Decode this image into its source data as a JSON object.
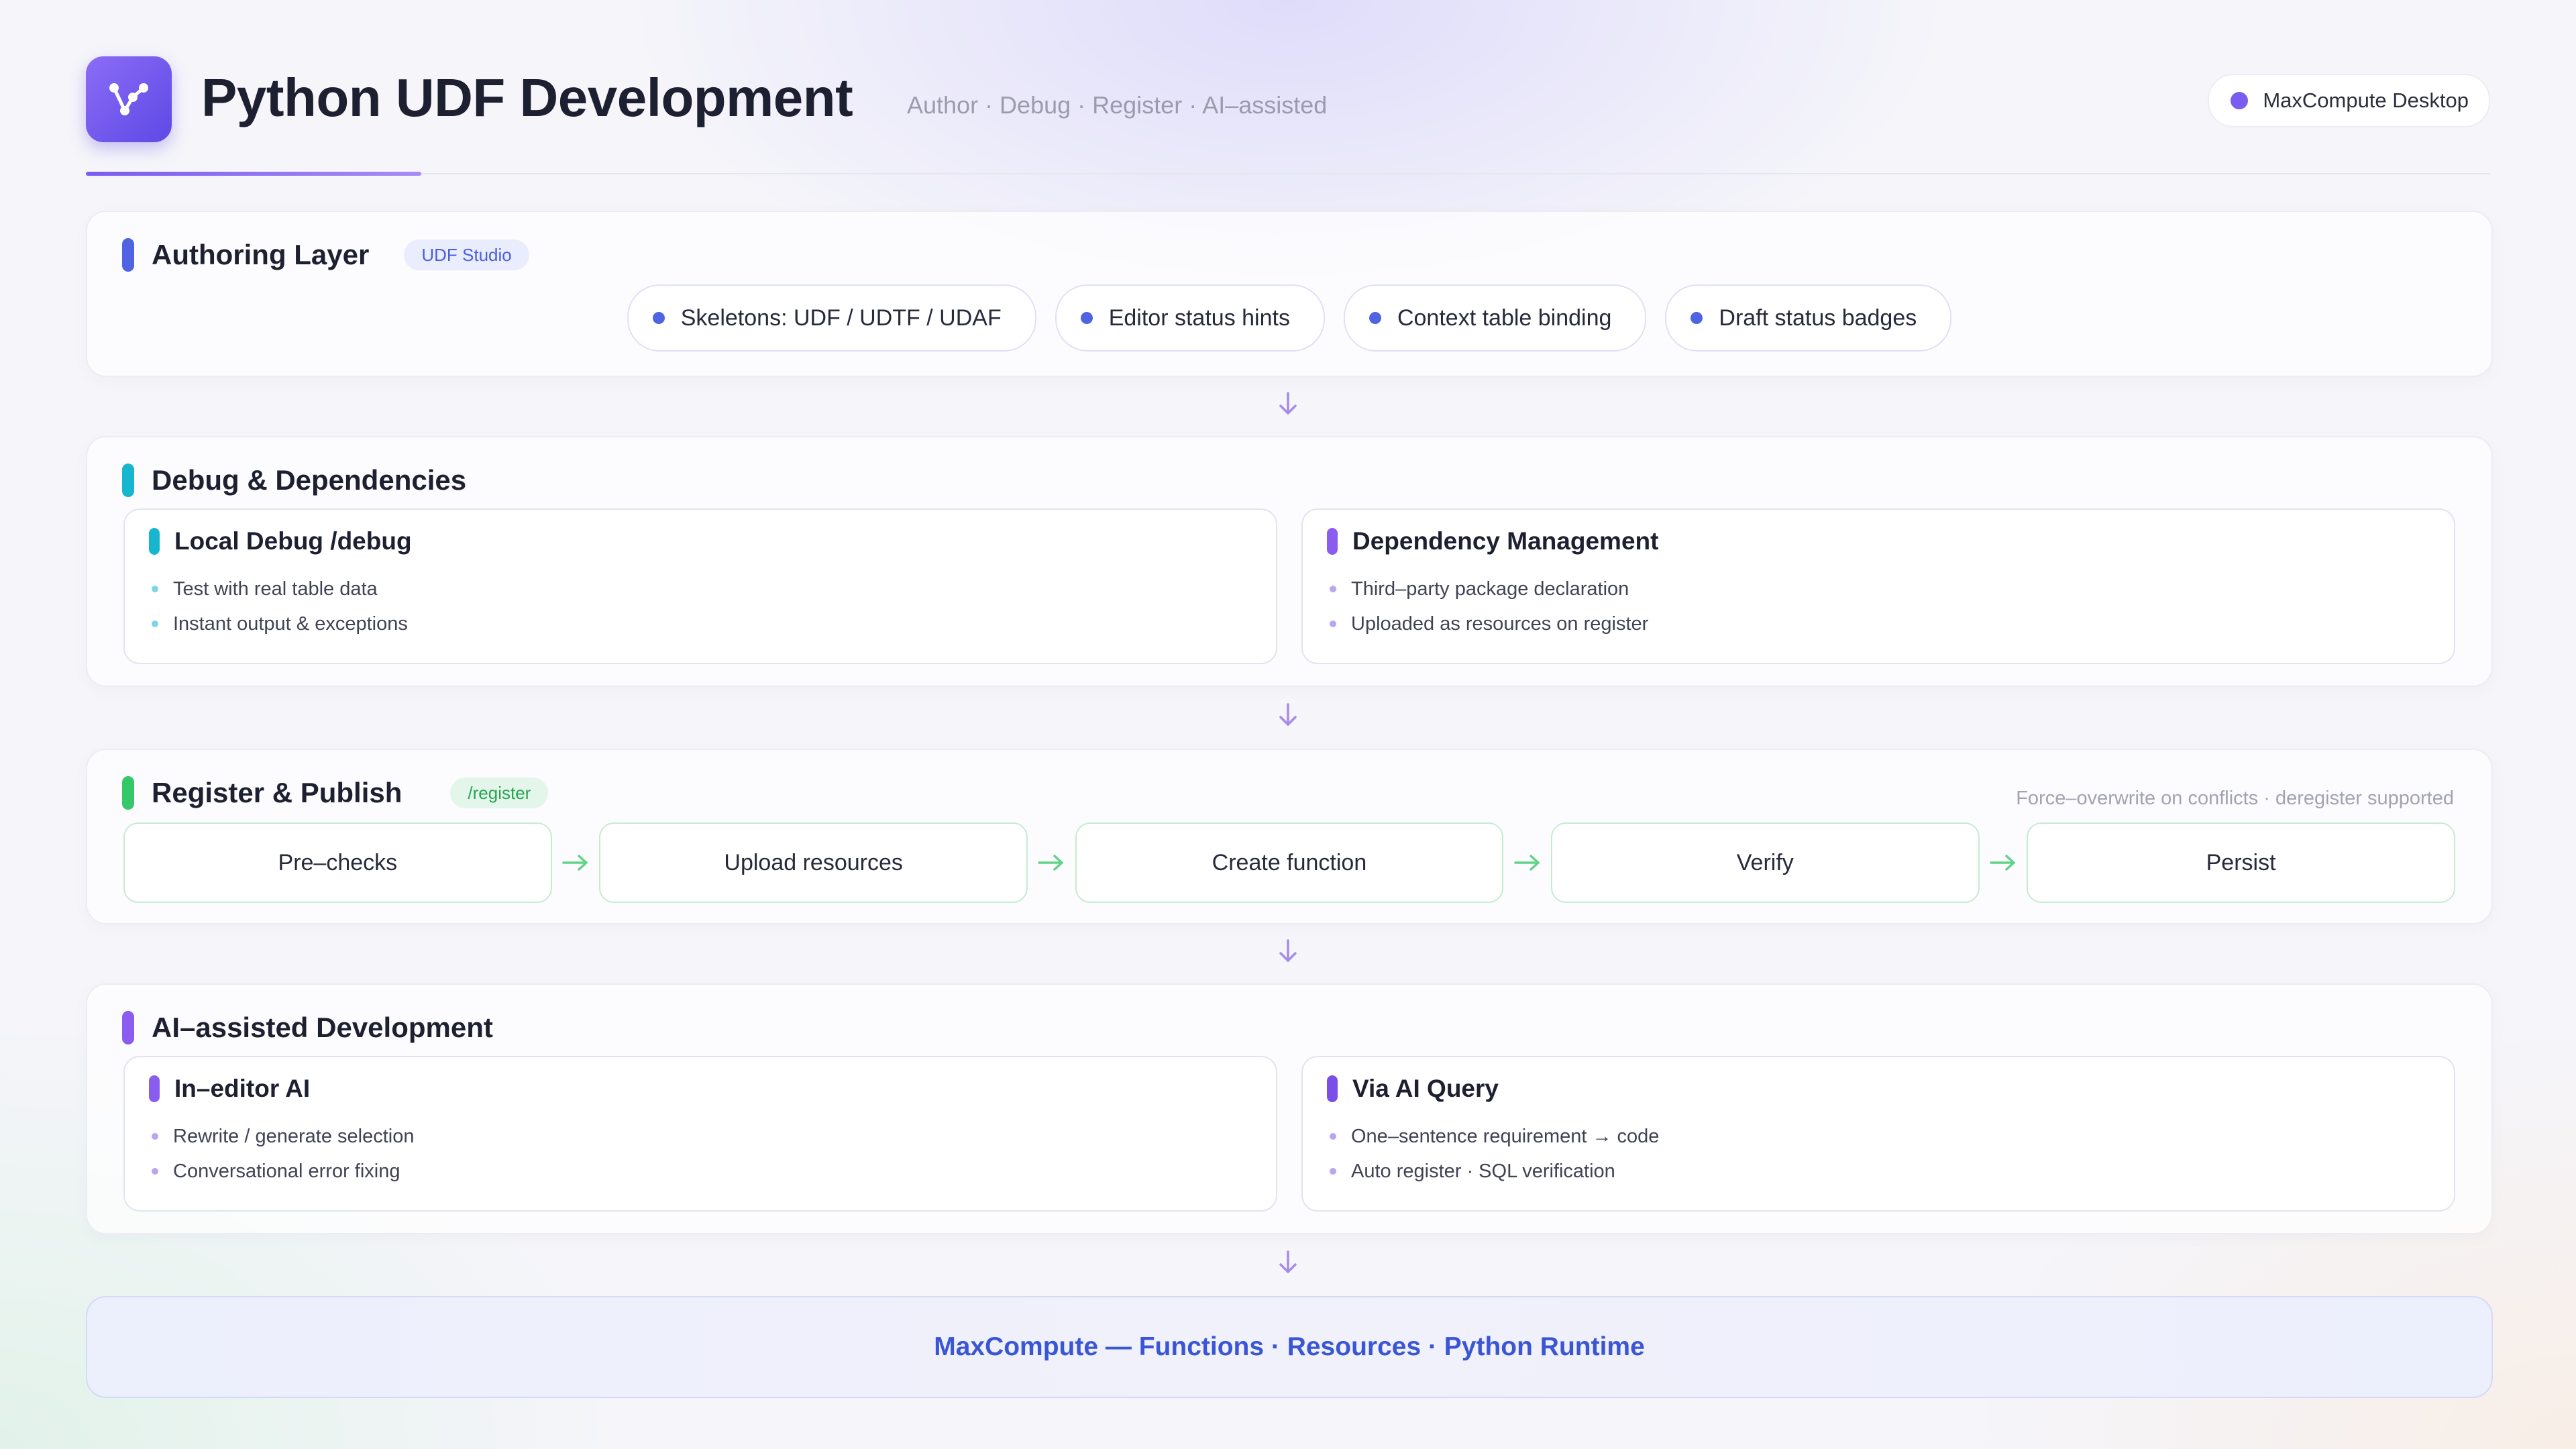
{
  "header": {
    "title": "Python UDF Development",
    "subtitle": "Author · Debug · Register · AI–assisted",
    "badge": "MaxCompute Desktop",
    "logo_icon": "function-graph-icon"
  },
  "authoring": {
    "title": "Authoring Layer",
    "tag": "UDF Studio",
    "items": [
      "Skeletons: UDF / UDTF / UDAF",
      "Editor status hints",
      "Context table binding",
      "Draft status badges"
    ]
  },
  "debug": {
    "title": "Debug & Dependencies",
    "cards": [
      {
        "title": "Local Debug /debug",
        "items": [
          "Test with real table data",
          "Instant output & exceptions"
        ]
      },
      {
        "title": "Dependency Management",
        "items": [
          "Third–party package declaration",
          "Uploaded as resources on register"
        ]
      }
    ]
  },
  "register": {
    "title": "Register & Publish",
    "tag": "/register",
    "note": "Force–overwrite on conflicts · deregister supported",
    "steps": [
      "Pre–checks",
      "Upload resources",
      "Create function",
      "Verify",
      "Persist"
    ]
  },
  "ai": {
    "title": "AI–assisted Development",
    "cards": [
      {
        "title": "In–editor AI",
        "items": [
          "Rewrite / generate selection",
          "Conversational error fixing"
        ]
      },
      {
        "title": "Via AI Query",
        "items": [
          "One–sentence requirement → code",
          "Auto register · SQL verification"
        ]
      }
    ]
  },
  "footer": {
    "text": "MaxCompute — Functions · Resources · Python Runtime"
  },
  "colors": {
    "blue": "#4f63e3",
    "cyan": "#16b6cf",
    "purple": "#8a5cf0",
    "green": "#35c768",
    "violet": "#7b4ee8"
  }
}
